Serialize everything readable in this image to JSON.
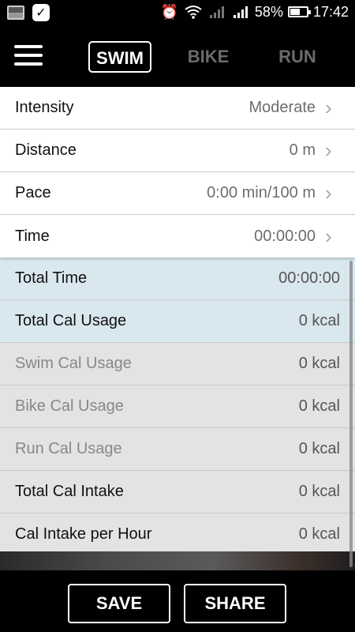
{
  "status_bar": {
    "battery_percent": "58%",
    "time": "17:42",
    "battery_level": 0.58,
    "icons": [
      "image-icon",
      "checkmark-icon",
      "alarm-icon",
      "wifi-icon",
      "signal-icon",
      "signal-icon",
      "battery-icon"
    ]
  },
  "nav": {
    "menu_icon": "hamburger-menu-icon",
    "tabs": [
      {
        "label": "SWIM",
        "active": true
      },
      {
        "label": "BIKE",
        "active": false
      },
      {
        "label": "RUN",
        "active": false
      }
    ]
  },
  "inputs": [
    {
      "label": "Intensity",
      "value": "Moderate"
    },
    {
      "label": "Distance",
      "value": "0 m"
    },
    {
      "label": "Pace",
      "value": "0:00 min/100 m"
    },
    {
      "label": "Time",
      "value": "00:00:00"
    }
  ],
  "results": [
    {
      "label": "Total Time",
      "value": "00:00:00"
    },
    {
      "label": "Total Cal Usage",
      "value": "0 kcal"
    },
    {
      "label": "Swim Cal Usage",
      "value": "0 kcal"
    },
    {
      "label": "Bike Cal Usage",
      "value": "0 kcal"
    },
    {
      "label": "Run Cal Usage",
      "value": "0 kcal"
    },
    {
      "label": "Total Cal Intake",
      "value": "0 kcal"
    },
    {
      "label": "Cal Intake per Hour",
      "value": "0 kcal"
    }
  ],
  "actions": {
    "save_label": "SAVE",
    "share_label": "SHARE"
  },
  "colors": {
    "highlight": "#d9e7ef",
    "background": "#000000",
    "list_bg": "#e3e3e3"
  }
}
